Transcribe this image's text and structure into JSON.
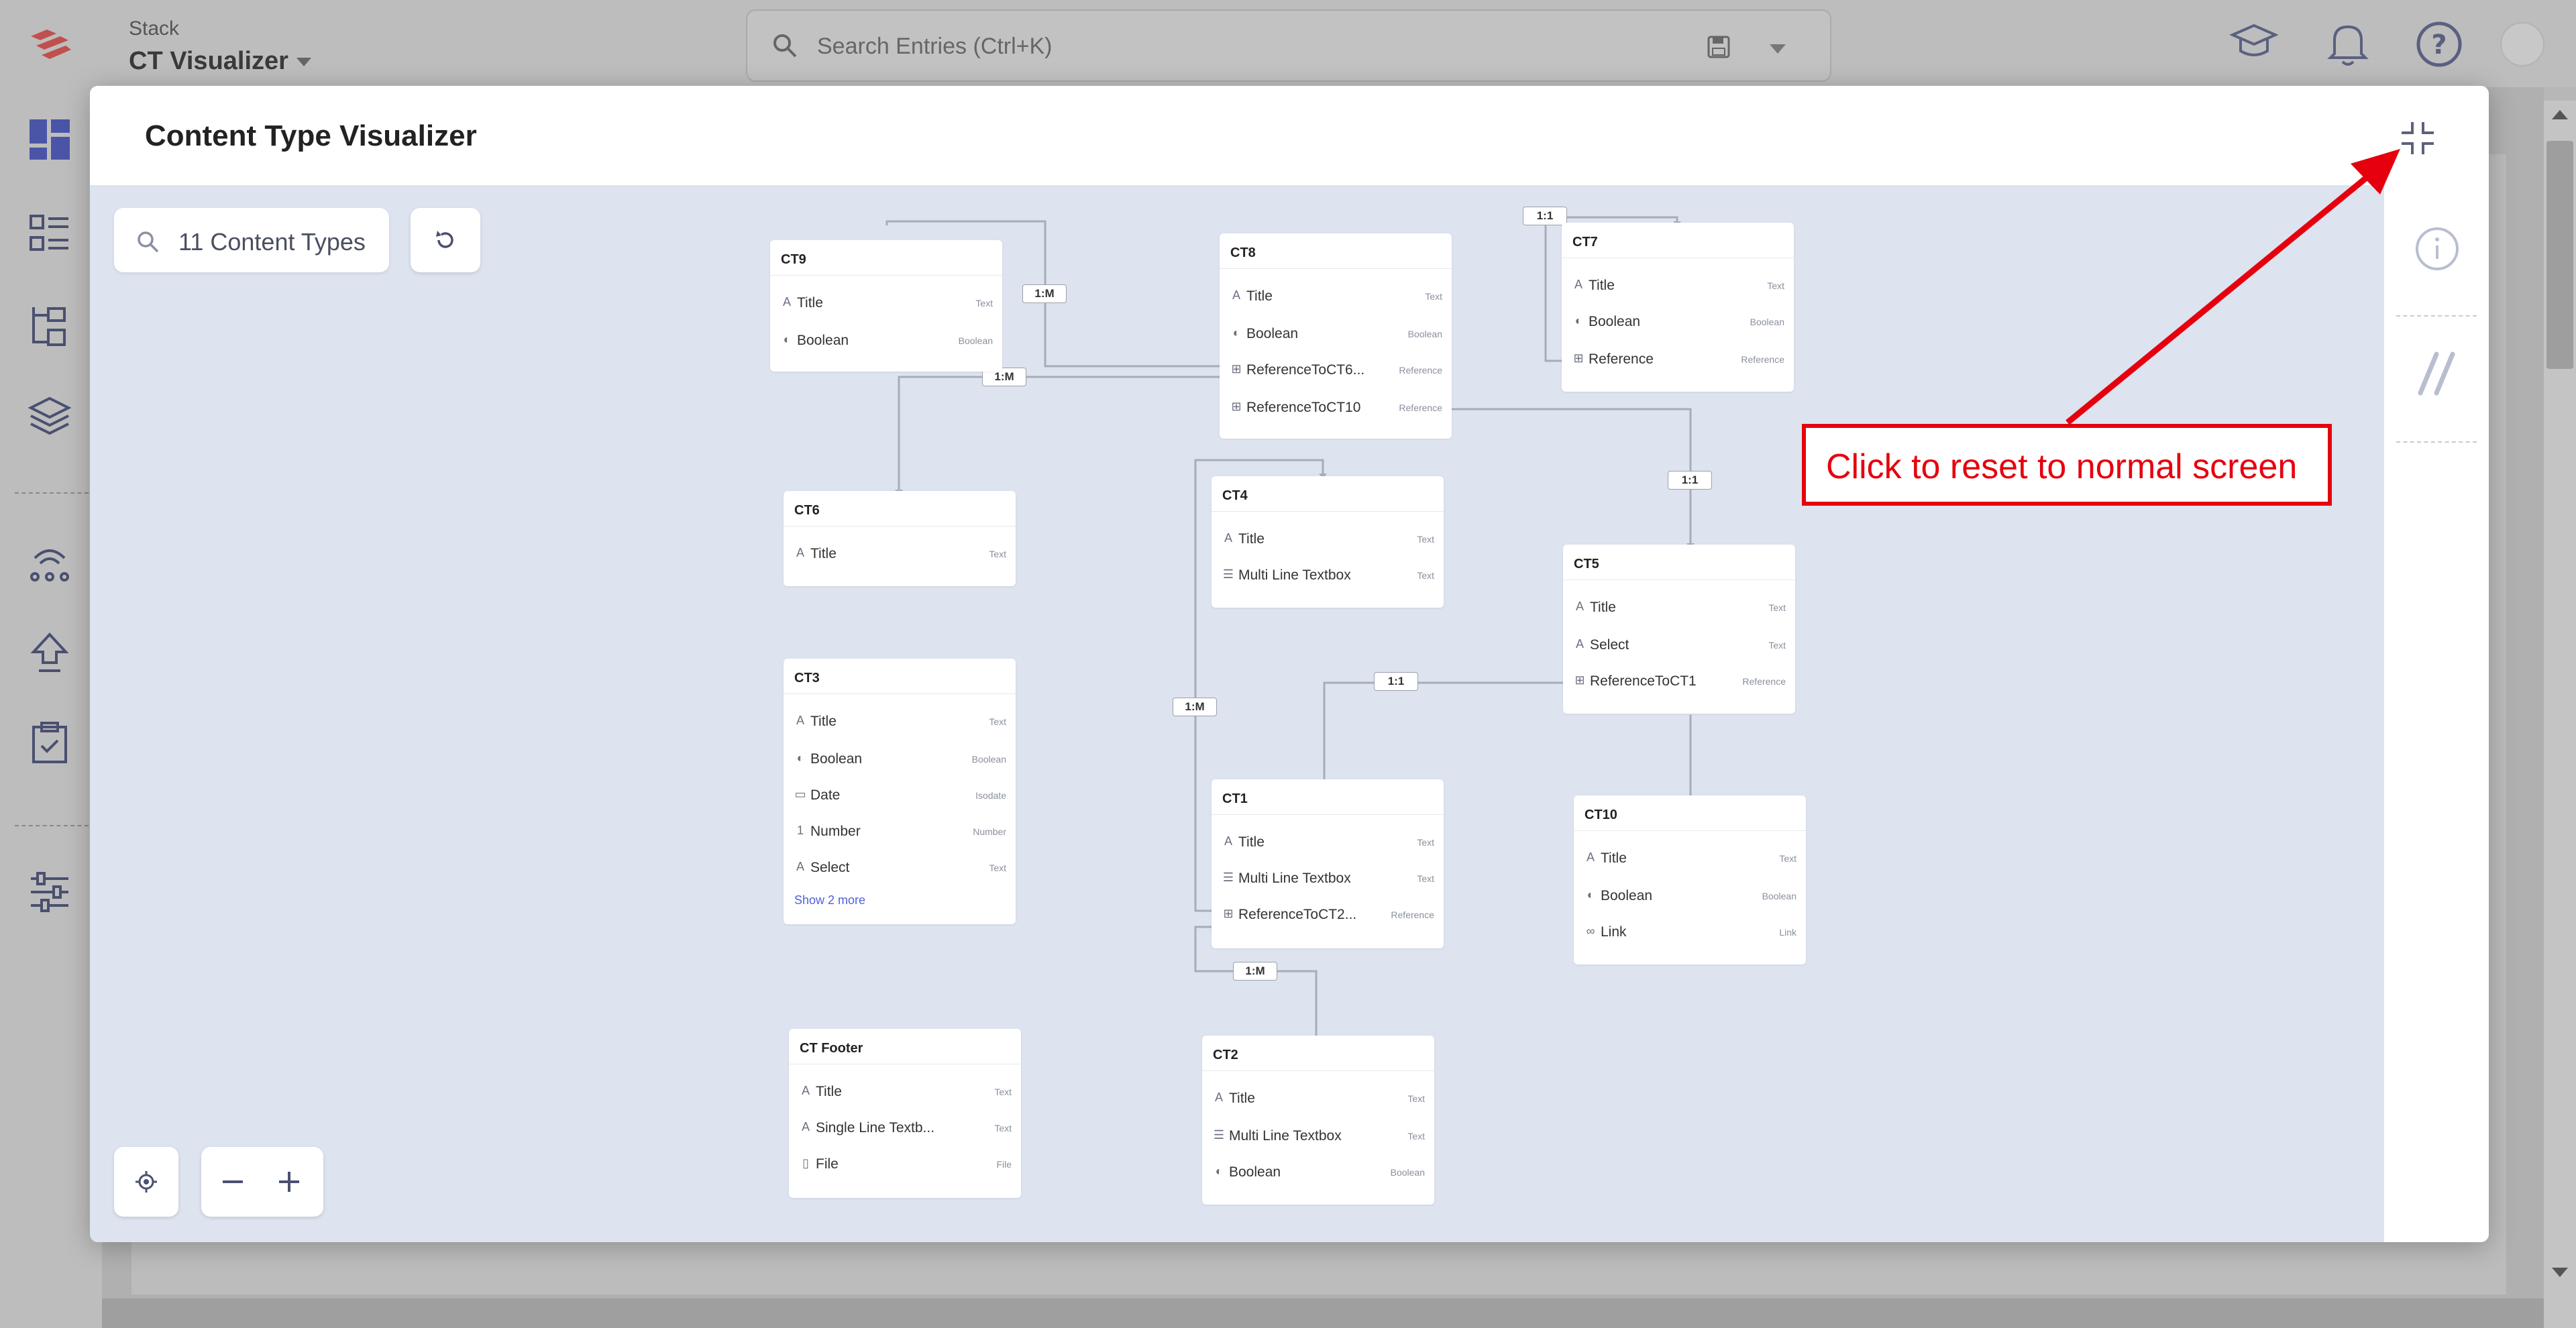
{
  "header": {
    "stack_label": "Stack",
    "stack_name": "CT Visualizer",
    "search_placeholder": "Search Entries (Ctrl+K)"
  },
  "modal": {
    "title": "Content Type Visualizer",
    "search_text": "11 Content Types"
  },
  "cards": {
    "ct9": {
      "name": "CT9",
      "fields": [
        {
          "name": "Title",
          "type": "Text",
          "icon": "text-icon"
        },
        {
          "name": "Boolean",
          "type": "Boolean",
          "icon": "boolean-icon"
        }
      ]
    },
    "ct8": {
      "name": "CT8",
      "fields": [
        {
          "name": "Title",
          "type": "Text",
          "icon": "text-icon"
        },
        {
          "name": "Boolean",
          "type": "Boolean",
          "icon": "boolean-icon"
        },
        {
          "name": "ReferenceToCT6...",
          "type": "Reference",
          "icon": "reference-icon"
        },
        {
          "name": "ReferenceToCT10",
          "type": "Reference",
          "icon": "reference-icon"
        }
      ]
    },
    "ct7": {
      "name": "CT7",
      "fields": [
        {
          "name": "Title",
          "type": "Text",
          "icon": "text-icon"
        },
        {
          "name": "Boolean",
          "type": "Boolean",
          "icon": "boolean-icon"
        },
        {
          "name": "Reference",
          "type": "Reference",
          "icon": "reference-icon"
        }
      ]
    },
    "ct6": {
      "name": "CT6",
      "fields": [
        {
          "name": "Title",
          "type": "Text",
          "icon": "text-icon"
        }
      ]
    },
    "ct4": {
      "name": "CT4",
      "fields": [
        {
          "name": "Title",
          "type": "Text",
          "icon": "text-icon"
        },
        {
          "name": "Multi Line Textbox",
          "type": "Text",
          "icon": "multiline-icon"
        }
      ]
    },
    "ct5": {
      "name": "CT5",
      "fields": [
        {
          "name": "Title",
          "type": "Text",
          "icon": "text-icon"
        },
        {
          "name": "Select",
          "type": "Text",
          "icon": "text-icon"
        },
        {
          "name": "ReferenceToCT1",
          "type": "Reference",
          "icon": "reference-icon"
        }
      ]
    },
    "ct3": {
      "name": "CT3",
      "fields": [
        {
          "name": "Title",
          "type": "Text",
          "icon": "text-icon"
        },
        {
          "name": "Boolean",
          "type": "Boolean",
          "icon": "boolean-icon"
        },
        {
          "name": "Date",
          "type": "Isodate",
          "icon": "date-icon"
        },
        {
          "name": "Number",
          "type": "Number",
          "icon": "number-icon"
        },
        {
          "name": "Select",
          "type": "Text",
          "icon": "text-icon"
        }
      ],
      "show_more": "Show 2 more"
    },
    "ct1": {
      "name": "CT1",
      "fields": [
        {
          "name": "Title",
          "type": "Text",
          "icon": "text-icon"
        },
        {
          "name": "Multi Line Textbox",
          "type": "Text",
          "icon": "multiline-icon"
        },
        {
          "name": "ReferenceToCT2...",
          "type": "Reference",
          "icon": "reference-icon"
        }
      ]
    },
    "ct10": {
      "name": "CT10",
      "fields": [
        {
          "name": "Title",
          "type": "Text",
          "icon": "text-icon"
        },
        {
          "name": "Boolean",
          "type": "Boolean",
          "icon": "boolean-icon"
        },
        {
          "name": "Link",
          "type": "Link",
          "icon": "link-icon"
        }
      ]
    },
    "ctfooter": {
      "name": "CT Footer",
      "fields": [
        {
          "name": "Title",
          "type": "Text",
          "icon": "text-icon"
        },
        {
          "name": "Single Line Textb...",
          "type": "Text",
          "icon": "text-icon"
        },
        {
          "name": "File",
          "type": "File",
          "icon": "file-icon"
        }
      ]
    },
    "ct2": {
      "name": "CT2",
      "fields": [
        {
          "name": "Title",
          "type": "Text",
          "icon": "text-icon"
        },
        {
          "name": "Multi Line Textbox",
          "type": "Text",
          "icon": "multiline-icon"
        },
        {
          "name": "Boolean",
          "type": "Boolean",
          "icon": "boolean-icon"
        }
      ]
    }
  },
  "relations": {
    "ct9_ct8": "1:M",
    "ct9_ct6": "1:M",
    "ct7_self": "1:1",
    "ct8_ct5": "1:1",
    "ct4_ct1": "1:M",
    "ct5_ct1": "1:1",
    "ct1_ct2": "1:M"
  },
  "annotation": {
    "text": "Click to reset to normal screen",
    "color": "#e6000e"
  },
  "colors": {
    "canvas_bg": "#dde3ef",
    "accent": "#5060d8"
  }
}
